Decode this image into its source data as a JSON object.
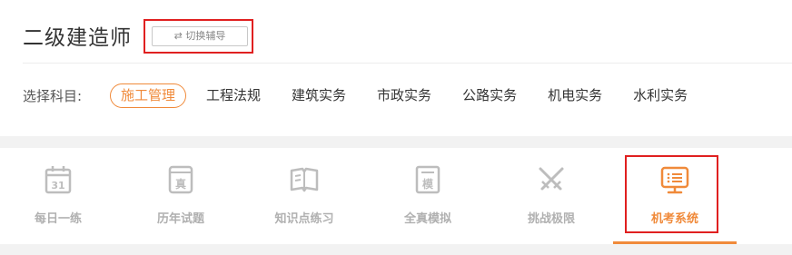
{
  "header": {
    "title": "二级建造师",
    "switch_label": "⇄ 切换辅导"
  },
  "subjects": {
    "label": "选择科目:",
    "items": [
      "施工管理",
      "工程法规",
      "建筑实务",
      "市政实务",
      "公路实务",
      "机电实务",
      "水利实务"
    ],
    "active_index": 0
  },
  "tabs": {
    "items": [
      {
        "label": "每日一练",
        "icon": "calendar-icon",
        "icon_text": "31"
      },
      {
        "label": "历年试题",
        "icon": "exam-book-icon",
        "icon_text": "真"
      },
      {
        "label": "知识点练习",
        "icon": "open-book-icon",
        "icon_text": ""
      },
      {
        "label": "全真模拟",
        "icon": "mock-exam-icon",
        "icon_text": "模"
      },
      {
        "label": "挑战极限",
        "icon": "crossed-swords-icon",
        "icon_text": ""
      },
      {
        "label": "机考系统",
        "icon": "computer-test-icon",
        "icon_text": ""
      }
    ],
    "active_index": 5
  },
  "colors": {
    "accent": "#f08a3a",
    "highlight_box": "#e02020",
    "inactive_tab": "#b0b0b0"
  }
}
